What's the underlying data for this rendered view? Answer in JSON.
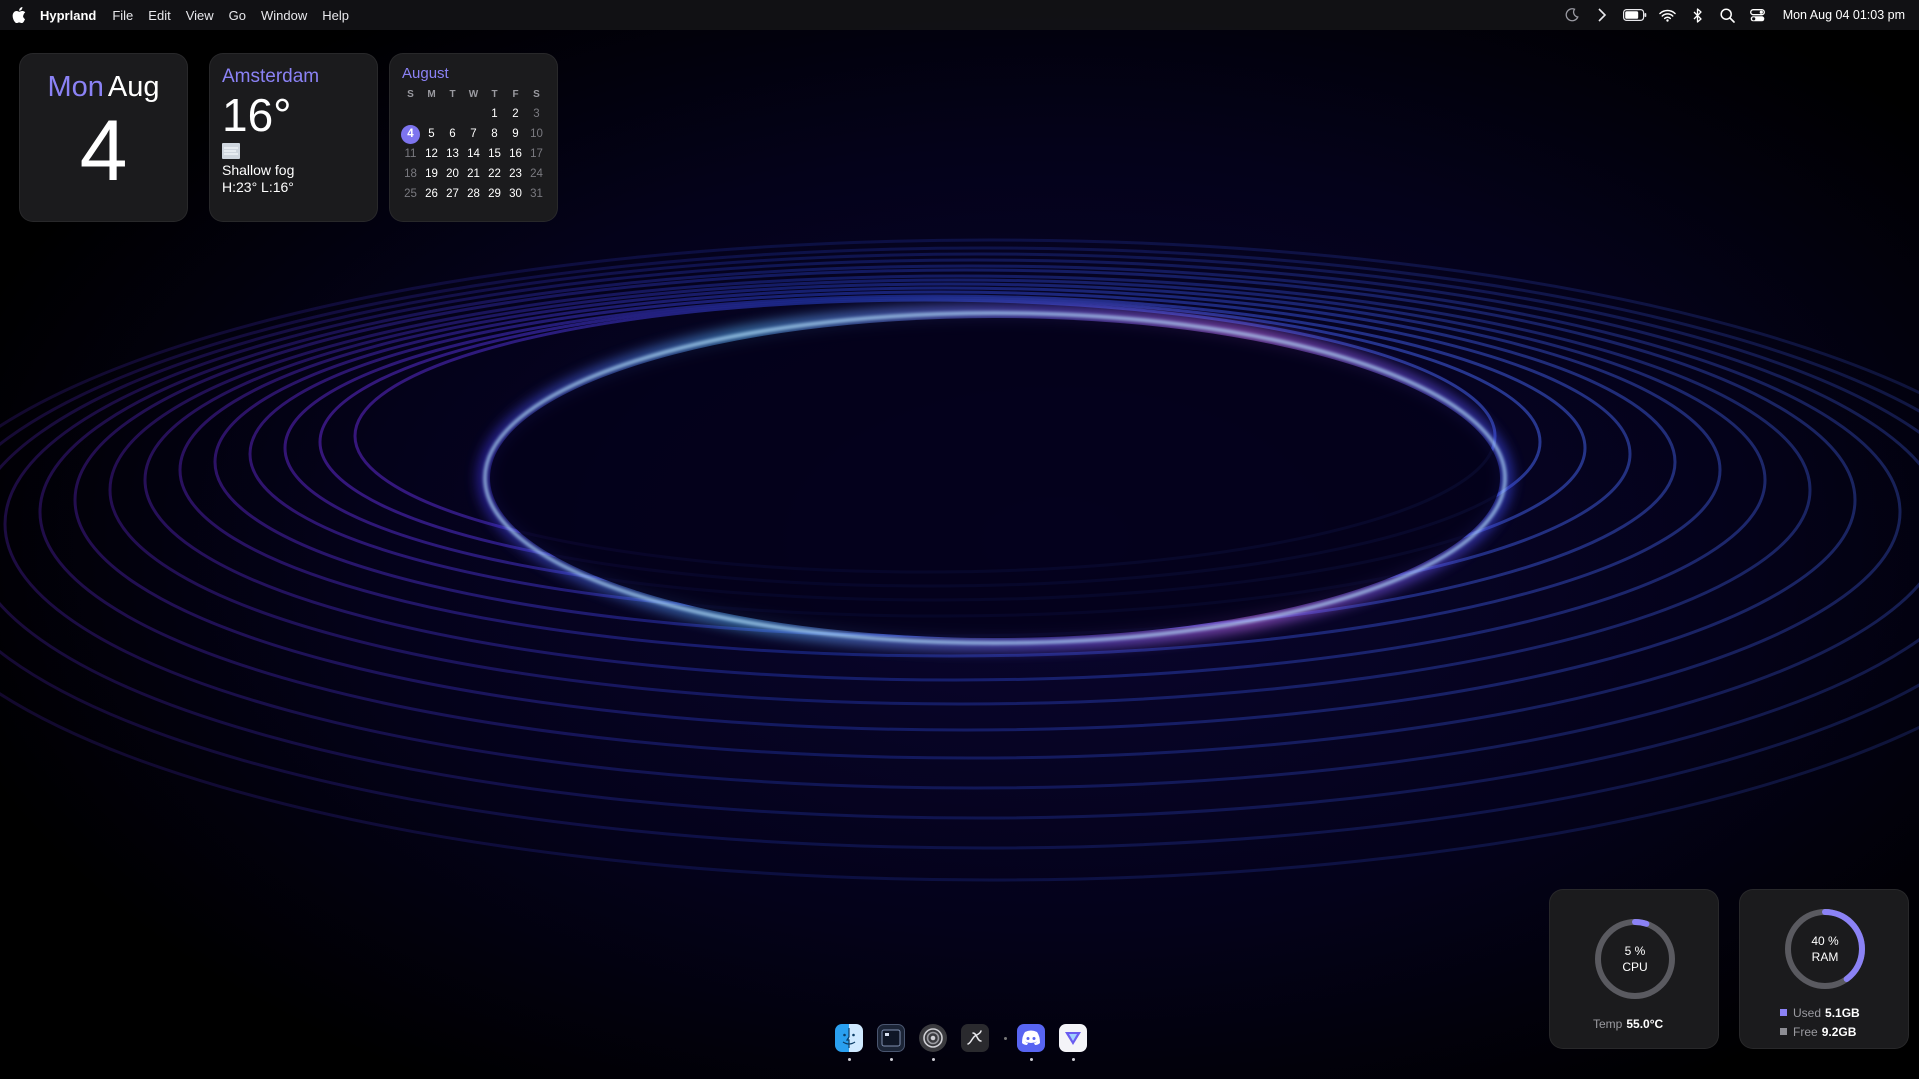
{
  "menubar": {
    "apple_icon": "apple-logo-icon",
    "app_name": "Hyprland",
    "menus": [
      "File",
      "Edit",
      "View",
      "Go",
      "Window",
      "Help"
    ],
    "tray_icons": [
      "moon-icon",
      "chevron-right-icon",
      "battery-icon",
      "wifi-icon",
      "bluetooth-icon",
      "search-icon",
      "control-center-icon"
    ],
    "clock": "Mon Aug 04 01:03 pm"
  },
  "widgets": {
    "date": {
      "weekday": "Mon",
      "month": "Aug",
      "day": "4"
    },
    "weather": {
      "city": "Amsterdam",
      "temperature": "16°",
      "icon": "fog-icon",
      "condition": "Shallow fog",
      "high_low": "H:23° L:16°"
    },
    "calendar": {
      "title": "August",
      "headers": [
        "S",
        "M",
        "T",
        "W",
        "T",
        "F",
        "S"
      ],
      "weeks": [
        [
          "",
          "",
          "",
          "",
          "1",
          "2",
          "3"
        ],
        [
          "4",
          "5",
          "6",
          "7",
          "8",
          "9",
          "10"
        ],
        [
          "11",
          "12",
          "13",
          "14",
          "15",
          "16",
          "17"
        ],
        [
          "18",
          "19",
          "20",
          "21",
          "22",
          "23",
          "24"
        ],
        [
          "25",
          "26",
          "27",
          "28",
          "29",
          "30",
          "31"
        ]
      ],
      "today": "4"
    },
    "cpu": {
      "percent_label": "5 %",
      "label": "CPU",
      "usage": 0.05,
      "temp_label": "Temp",
      "temp_value": "55.0°C"
    },
    "ram": {
      "percent_label": "40 %",
      "label": "RAM",
      "usage": 0.4,
      "used_label": "Used",
      "used_value": "5.1GB",
      "free_label": "Free",
      "free_value": "9.2GB"
    }
  },
  "dock": {
    "apps": [
      {
        "name": "finder-icon",
        "running": true
      },
      {
        "name": "terminal-icon",
        "running": true
      },
      {
        "name": "settings-icon",
        "running": true
      },
      {
        "name": "script-editor-icon",
        "running": false
      },
      {
        "name": "discord-icon",
        "running": true
      },
      {
        "name": "browser-icon",
        "running": true
      }
    ]
  },
  "colors": {
    "accent": "#8b82f5",
    "today_highlight": "#7d74ef",
    "widget_bg": "#1c1c1e",
    "menubar_bg": "#121216"
  }
}
